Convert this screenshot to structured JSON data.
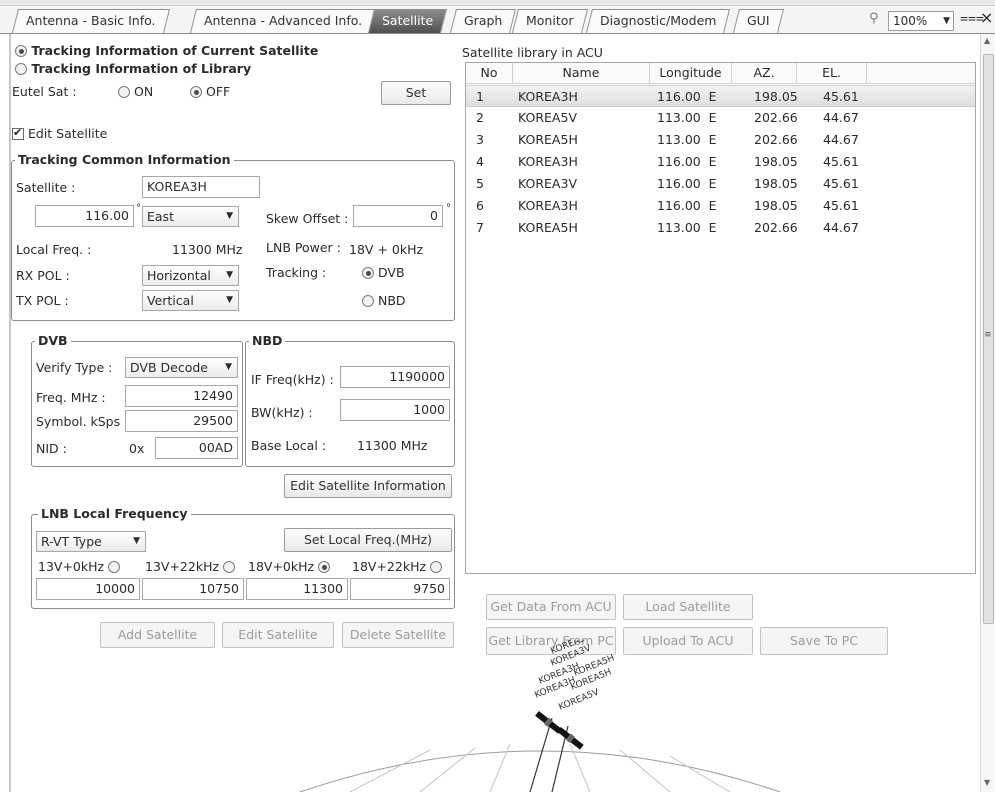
{
  "tabs": [
    {
      "label": "Antenna - Basic Info.",
      "active": false
    },
    {
      "label": "Antenna - Advanced Info.",
      "active": false
    },
    {
      "label": "Satellite",
      "active": true
    },
    {
      "label": "Graph",
      "active": false
    },
    {
      "label": "Monitor",
      "active": false
    },
    {
      "label": "Diagnostic/Modem",
      "active": false
    },
    {
      "label": "GUI",
      "active": false
    }
  ],
  "toolbar": {
    "zoom": "100%",
    "close": "×",
    "overflow": "⩶",
    "pin": "⚲"
  },
  "tracking": {
    "current": "Tracking Information of Current Satellite",
    "library": "Tracking Information of Library",
    "eutel_label": "Eutel Sat :",
    "on": "ON",
    "off": "OFF",
    "set": "Set",
    "edit_satellite": "Edit Satellite"
  },
  "common": {
    "legend": "Tracking Common  Information",
    "satellite_label": "Satellite :",
    "satellite_value": "KOREA3H",
    "longitude_value": "116.00",
    "degree": "°",
    "direction": "East",
    "skew_label": "Skew Offset :",
    "skew_value": "0",
    "skew_degree": "°",
    "local_freq_label": "Local Freq. :",
    "local_freq_value": "11300 MHz",
    "lnb_power_label": "LNB Power :",
    "lnb_power_value": "18V + 0kHz",
    "rx_pol_label": "RX POL :",
    "rx_pol_value": "Horizontal",
    "tracking_label": "Tracking :",
    "dvb": "DVB",
    "nbd": "NBD",
    "tx_pol_label": "TX POL :",
    "tx_pol_value": "Vertical"
  },
  "dvb": {
    "legend": "DVB",
    "verify_label": "Verify Type :",
    "verify_value": "DVB Decode",
    "freq_label": "Freq. MHz :",
    "freq_value": "12490",
    "symbol_label": "Symbol. kSps :",
    "symbol_value": "29500",
    "nid_label": "NID :",
    "nid_prefix": "0x",
    "nid_value": "00AD"
  },
  "nbd": {
    "legend": "NBD",
    "if_label": "IF Freq(kHz) :",
    "if_value": "1190000",
    "bw_label": "BW(kHz) :",
    "bw_value": "1000",
    "base_label": "Base Local :",
    "base_value": "11300 MHz"
  },
  "edit_info_button": "Edit Satellite Information",
  "lnb": {
    "legend": "LNB Local Frequency",
    "type_value": "R-VT Type",
    "set_button": "Set Local Freq.(MHz)",
    "options": [
      {
        "label": "13V+0kHz",
        "value": "10000",
        "selected": false
      },
      {
        "label": "13V+22kHz",
        "value": "10750",
        "selected": false
      },
      {
        "label": "18V+0kHz",
        "value": "11300",
        "selected": true
      },
      {
        "label": "18V+22kHz",
        "value": "9750",
        "selected": false
      }
    ]
  },
  "actions": {
    "add": "Add Satellite",
    "edit": "Edit Satellite",
    "delete": "Delete Satellite"
  },
  "library": {
    "title": "Satellite library in ACU",
    "columns": [
      "No",
      "Name",
      "Longitude",
      "AZ.",
      "EL."
    ],
    "rows": [
      {
        "no": "1",
        "name": "KOREA3H",
        "lon": "116.00  E",
        "az": "198.05",
        "el": "45.61"
      },
      {
        "no": "2",
        "name": "KOREA5V",
        "lon": "113.00  E",
        "az": "202.66",
        "el": "44.67"
      },
      {
        "no": "3",
        "name": "KOREA5H",
        "lon": "113.00  E",
        "az": "202.66",
        "el": "44.67"
      },
      {
        "no": "4",
        "name": "KOREA3H",
        "lon": "116.00  E",
        "az": "198.05",
        "el": "45.61"
      },
      {
        "no": "5",
        "name": "KOREA3V",
        "lon": "116.00  E",
        "az": "198.05",
        "el": "45.61"
      },
      {
        "no": "6",
        "name": "KOREA3H",
        "lon": "116.00  E",
        "az": "198.05",
        "el": "45.61"
      },
      {
        "no": "7",
        "name": "KOREA5H",
        "lon": "113.00  E",
        "az": "202.66",
        "el": "44.67"
      }
    ],
    "selected_row": 1
  },
  "lib_buttons": {
    "get_data": "Get Data From ACU",
    "load": "Load Satellite",
    "get_library": "Get Library From PC",
    "upload": "Upload To ACU",
    "save": "Save To PC"
  },
  "sky_labels": [
    "KOREA3H",
    "KOREA3V",
    "KOREA3H",
    "KOREA5H",
    "KOREA3H",
    "KOREA5H",
    "KOREA5V"
  ]
}
